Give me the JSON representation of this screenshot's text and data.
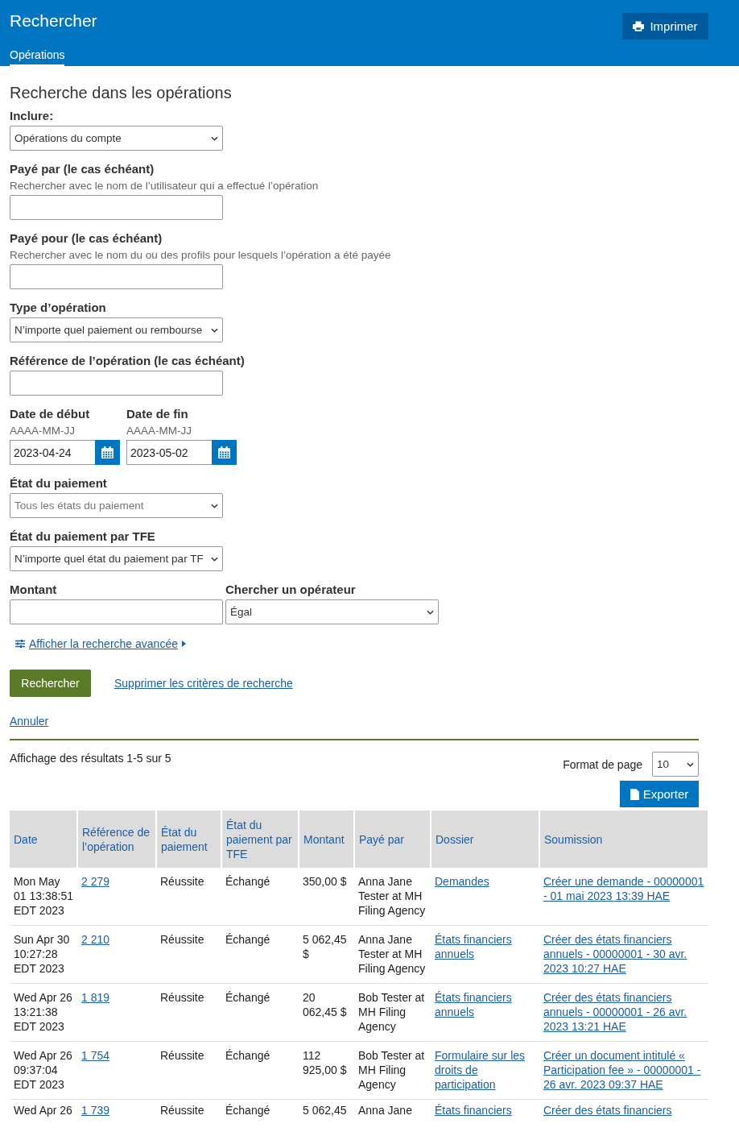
{
  "header": {
    "title": "Rechercher",
    "print_button": "Imprimer",
    "tabs": [
      {
        "label": "Opérations",
        "selected": true
      }
    ]
  },
  "form": {
    "heading": "Recherche dans les opérations",
    "fields": [
      {
        "kind": "select",
        "label": "Inclure:",
        "value": "Opérations du compte"
      },
      {
        "kind": "input",
        "label": "Payé par (le cas échéant)",
        "hint": "Rechercher avec le nom de l’utilisateur qui a effectué l’opération"
      },
      {
        "kind": "input",
        "label": "Payé pour (le cas échéant)",
        "hint": "Rechercher avec le nom du ou des profils pour lesquels l’opération a été payée"
      },
      {
        "kind": "select",
        "label": "Type d’opération",
        "value": "N’importe quel paiement ou rembourse"
      },
      {
        "kind": "input",
        "label": "Référence de l’opération (le cas échéant)"
      },
      {
        "kind": "dates",
        "items": [
          {
            "label": "Date de début",
            "hint": "AAAA-MM-JJ",
            "value": "2023-04-24"
          },
          {
            "label": "Date de fin",
            "hint": "AAAA-MM-JJ",
            "value": "2023-05-02"
          }
        ]
      },
      {
        "kind": "select",
        "label": "État du paiement",
        "placeholder": "Tous les états du paiement"
      },
      {
        "kind": "select",
        "label": "État du paiement par TFE",
        "value": "N’importe quel état du paiement par TF"
      },
      {
        "kind": "pair",
        "items": [
          {
            "kind": "input",
            "label": "Montant"
          },
          {
            "kind": "select",
            "label": "Chercher un opérateur",
            "value": "Égal"
          }
        ]
      }
    ],
    "advanced_link": "Afficher la recherche avancée",
    "search_button": "Rechercher",
    "clear_link": "Supprimer les critères de recherche",
    "cancel_link": "Annuler"
  },
  "results": {
    "summary": "Affichage des résultats 1-5 sur 5",
    "page_size_label": "Format de page",
    "page_size": "10",
    "export_button": "Exporter",
    "table": {
      "columns": [
        {
          "label": "Date",
          "kind": "text"
        },
        {
          "label": "Référence de l’opération",
          "kind": "link"
        },
        {
          "label": "État du paiement",
          "kind": "text"
        },
        {
          "label": "État du paiement par TFE",
          "kind": "text"
        },
        {
          "label": "Montant",
          "kind": "text"
        },
        {
          "label": "Payé par",
          "kind": "text"
        },
        {
          "label": "Dossier",
          "kind": "link"
        },
        {
          "label": "Soumission",
          "kind": "link"
        }
      ],
      "rows": [
        [
          "Mon May 01 13:38:51 EDT 2023",
          "2 279",
          "Réussite",
          "Échangé",
          "350,00 $",
          "Anna Jane Tester at MH Filing Agency",
          "Demandes",
          "Créer une demande - 00000001 - 01 mai 2023 13:39 HAE"
        ],
        [
          "Sun Apr 30 10:27:28 EDT 2023",
          "2 210",
          "Réussite",
          "Échangé",
          "5 062,45 $",
          "Anna Jane Tester at MH Filing Agency",
          "États financiers annuels",
          "Créer des états financiers annuels - 00000001 - 30 avr. 2023 10:27 HAE"
        ],
        [
          "Wed Apr 26 13:21:38 EDT 2023",
          "1 819",
          "Réussite",
          "Échangé",
          "20 062,45 $",
          "Bob Tester at MH Filing Agency",
          "États financiers annuels",
          "Créer des états financiers annuels - 00000001 - 26 avr. 2023 13:21 HAE"
        ],
        [
          "Wed Apr 26 09:37:04 EDT 2023",
          "1 754",
          "Réussite",
          "Échangé",
          "112 925,00 $",
          "Bob Tester at MH Filing Agency",
          "Formulaire sur les droits de participation",
          "Créer un document intitulé « Participation fee » - 00000001 - 26 avr. 2023 09:37 HAE"
        ],
        [
          "Wed Apr 26",
          "1 739",
          "Réussite",
          "Échangé",
          "5 062,45",
          "Anna Jane",
          "États financiers",
          "Créer des états financiers"
        ]
      ]
    }
  }
}
